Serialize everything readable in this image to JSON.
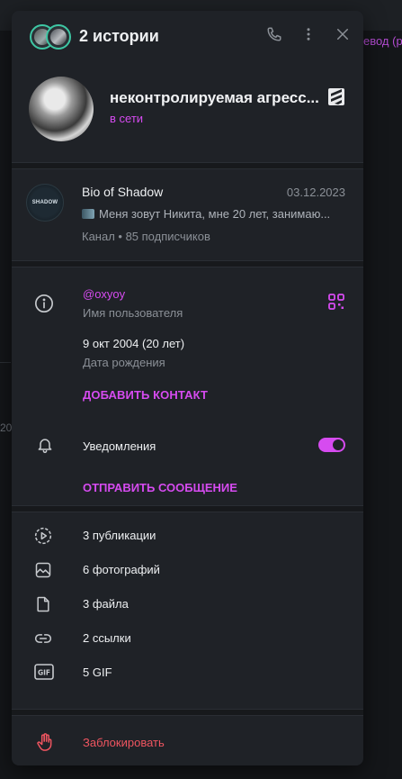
{
  "background": {
    "right_link": "евод (р",
    "left_number": "20"
  },
  "header": {
    "stories_title": "2 истории",
    "icons": [
      "phone-icon",
      "more-vertical-icon",
      "close-icon"
    ]
  },
  "profile": {
    "name": "неконтролируемая агресс...",
    "status": "в сети",
    "emoji_status": "stripe-logo-icon"
  },
  "channel": {
    "avatar_text": "SHADOW",
    "title": "Bio of Shadow",
    "date": "03.12.2023",
    "message": "Меня зовут Никита, мне 20 лет, занимаю...",
    "meta": "Канал • 85 подписчиков"
  },
  "info": {
    "username": "@oxyoy",
    "username_label": "Имя пользователя",
    "birthday": "9 окт 2004 (20 лет)",
    "birthday_label": "Дата рождения",
    "add_contact": "ДОБАВИТЬ КОНТАКТ",
    "notifications_label": "Уведомления",
    "notifications_on": true,
    "send_message": "ОТПРАВИТЬ СООБЩЕНИЕ"
  },
  "media": [
    {
      "icon": "stories-play-icon",
      "label": "3 публикации"
    },
    {
      "icon": "photo-icon",
      "label": "6 фотографий"
    },
    {
      "icon": "file-icon",
      "label": "3 файла"
    },
    {
      "icon": "link-icon",
      "label": "2 ссылки"
    },
    {
      "icon": "gif-icon",
      "label": "5 GIF"
    }
  ],
  "block": {
    "label": "Заблокировать"
  },
  "colors": {
    "accent": "#d64bf0",
    "danger": "#ef5560",
    "panel": "#1f2227",
    "online_ring": "#3ec7a4"
  }
}
